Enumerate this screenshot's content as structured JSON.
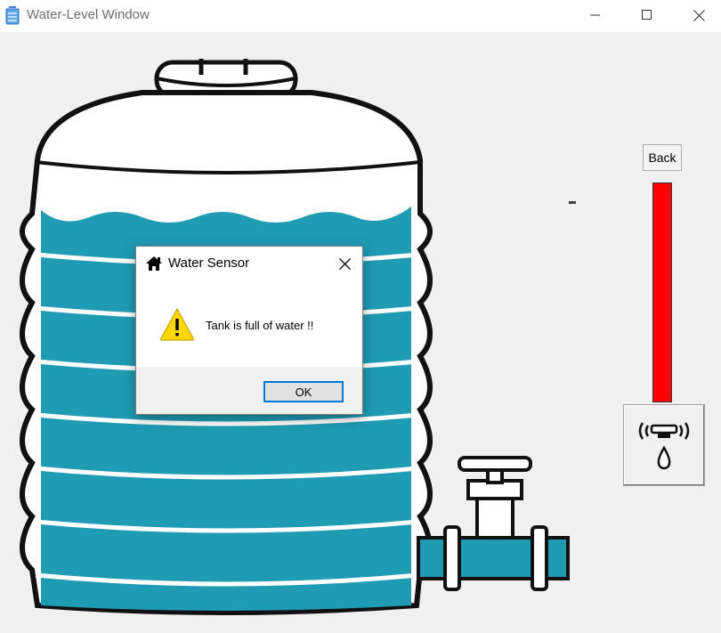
{
  "window": {
    "title": "Water-Level Window",
    "controls": [
      "minimize",
      "maximize",
      "close"
    ]
  },
  "icons": {
    "app": "water-tank-icon",
    "minimize": "minimize-icon",
    "maximize": "maximize-icon",
    "close": "close-icon",
    "dialog": "home-icon",
    "warning": "warning-icon",
    "sensor": "water-sensor-icon"
  },
  "main": {
    "back_label": "Back",
    "level": {
      "fill_fraction": 1.0,
      "color": "#ff0000"
    },
    "tank": {
      "water_color": "#1f9cb3",
      "outline_color": "#111111"
    }
  },
  "dialog": {
    "title": "Water Sensor",
    "message": "Tank is full of water !!",
    "ok_label": "OK",
    "accent": "#0078d7",
    "warning_color": "#ffd700"
  }
}
